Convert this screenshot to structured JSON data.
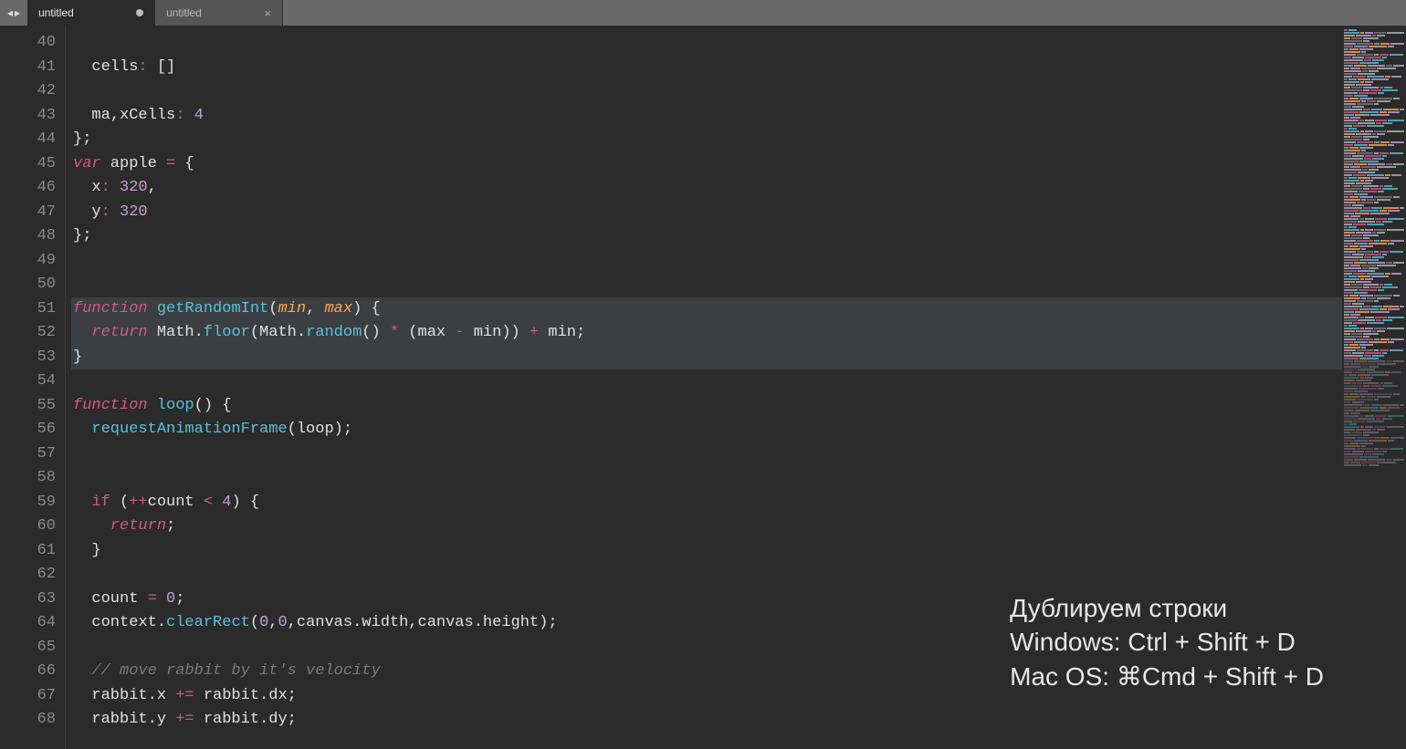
{
  "tabs": [
    {
      "label": "untitled",
      "active": true,
      "dirty": true
    },
    {
      "label": "untitled",
      "active": false,
      "dirty": false
    }
  ],
  "first_line_number": 40,
  "lines": [
    {
      "n": 40,
      "sel": false,
      "tokens": []
    },
    {
      "n": 41,
      "sel": false,
      "tokens": [
        {
          "t": "  ",
          "c": "plain"
        },
        {
          "t": "cells",
          "c": "plain"
        },
        {
          "t": ":",
          "c": "op"
        },
        {
          "t": " [] ",
          "c": "plain"
        }
      ]
    },
    {
      "n": 42,
      "sel": false,
      "tokens": []
    },
    {
      "n": 43,
      "sel": false,
      "tokens": [
        {
          "t": "  ",
          "c": "plain"
        },
        {
          "t": "ma",
          "c": "plain"
        },
        {
          "t": ",",
          "c": "plain"
        },
        {
          "t": "xCells",
          "c": "plain"
        },
        {
          "t": ":",
          "c": "op"
        },
        {
          "t": " ",
          "c": "plain"
        },
        {
          "t": "4",
          "c": "num"
        }
      ]
    },
    {
      "n": 44,
      "sel": false,
      "tokens": [
        {
          "t": "};",
          "c": "plain"
        }
      ]
    },
    {
      "n": 45,
      "sel": false,
      "tokens": [
        {
          "t": "var",
          "c": "kw"
        },
        {
          "t": " apple ",
          "c": "plain"
        },
        {
          "t": "=",
          "c": "op"
        },
        {
          "t": " {",
          "c": "plain"
        }
      ]
    },
    {
      "n": 46,
      "sel": false,
      "tokens": [
        {
          "t": "  x",
          "c": "plain"
        },
        {
          "t": ":",
          "c": "op"
        },
        {
          "t": " ",
          "c": "plain"
        },
        {
          "t": "320",
          "c": "num"
        },
        {
          "t": ",",
          "c": "plain"
        }
      ]
    },
    {
      "n": 47,
      "sel": false,
      "tokens": [
        {
          "t": "  y",
          "c": "plain"
        },
        {
          "t": ":",
          "c": "op"
        },
        {
          "t": " ",
          "c": "plain"
        },
        {
          "t": "320",
          "c": "num"
        }
      ]
    },
    {
      "n": 48,
      "sel": false,
      "tokens": [
        {
          "t": "};",
          "c": "plain"
        }
      ]
    },
    {
      "n": 49,
      "sel": false,
      "tokens": []
    },
    {
      "n": 50,
      "sel": false,
      "tokens": []
    },
    {
      "n": 51,
      "sel": true,
      "tokens": [
        {
          "t": "function",
          "c": "kw"
        },
        {
          "t": " ",
          "c": "plain"
        },
        {
          "t": "getRandomInt",
          "c": "fn"
        },
        {
          "t": "(",
          "c": "plain"
        },
        {
          "t": "min",
          "c": "param"
        },
        {
          "t": ", ",
          "c": "plain"
        },
        {
          "t": "max",
          "c": "param"
        },
        {
          "t": ") {",
          "c": "plain"
        }
      ]
    },
    {
      "n": 52,
      "sel": true,
      "tokens": [
        {
          "t": "  ",
          "c": "plain"
        },
        {
          "t": "return",
          "c": "kw"
        },
        {
          "t": " Math.",
          "c": "plain"
        },
        {
          "t": "floor",
          "c": "fn"
        },
        {
          "t": "(Math.",
          "c": "plain"
        },
        {
          "t": "random",
          "c": "fn"
        },
        {
          "t": "() ",
          "c": "plain"
        },
        {
          "t": "*",
          "c": "op"
        },
        {
          "t": " (max ",
          "c": "plain"
        },
        {
          "t": "-",
          "c": "op"
        },
        {
          "t": " min)) ",
          "c": "plain"
        },
        {
          "t": "+",
          "c": "op"
        },
        {
          "t": " min;",
          "c": "plain"
        }
      ]
    },
    {
      "n": 53,
      "sel": true,
      "tokens": [
        {
          "t": "}",
          "c": "plain"
        }
      ]
    },
    {
      "n": 54,
      "sel": false,
      "tokens": []
    },
    {
      "n": 55,
      "sel": false,
      "tokens": [
        {
          "t": "function",
          "c": "kw"
        },
        {
          "t": " ",
          "c": "plain"
        },
        {
          "t": "loop",
          "c": "fn"
        },
        {
          "t": "() {",
          "c": "plain"
        }
      ]
    },
    {
      "n": 56,
      "sel": false,
      "tokens": [
        {
          "t": "  ",
          "c": "plain"
        },
        {
          "t": "requestAnimationFrame",
          "c": "fn"
        },
        {
          "t": "(loop);",
          "c": "plain"
        }
      ]
    },
    {
      "n": 57,
      "sel": false,
      "tokens": []
    },
    {
      "n": 58,
      "sel": false,
      "tokens": []
    },
    {
      "n": 59,
      "sel": false,
      "tokens": [
        {
          "t": "  ",
          "c": "plain"
        },
        {
          "t": "if",
          "c": "kw2"
        },
        {
          "t": " (",
          "c": "plain"
        },
        {
          "t": "++",
          "c": "op"
        },
        {
          "t": "count ",
          "c": "plain"
        },
        {
          "t": "<",
          "c": "op"
        },
        {
          "t": " ",
          "c": "plain"
        },
        {
          "t": "4",
          "c": "num"
        },
        {
          "t": ") {",
          "c": "plain"
        }
      ]
    },
    {
      "n": 60,
      "sel": false,
      "tokens": [
        {
          "t": "    ",
          "c": "plain"
        },
        {
          "t": "return",
          "c": "kw"
        },
        {
          "t": ";",
          "c": "plain"
        }
      ]
    },
    {
      "n": 61,
      "sel": false,
      "tokens": [
        {
          "t": "  }",
          "c": "plain"
        }
      ]
    },
    {
      "n": 62,
      "sel": false,
      "tokens": []
    },
    {
      "n": 63,
      "sel": false,
      "tokens": [
        {
          "t": "  count ",
          "c": "plain"
        },
        {
          "t": "=",
          "c": "op"
        },
        {
          "t": " ",
          "c": "plain"
        },
        {
          "t": "0",
          "c": "num"
        },
        {
          "t": ";",
          "c": "plain"
        }
      ]
    },
    {
      "n": 64,
      "sel": false,
      "tokens": [
        {
          "t": "  context.",
          "c": "plain"
        },
        {
          "t": "clearRect",
          "c": "fn"
        },
        {
          "t": "(",
          "c": "plain"
        },
        {
          "t": "0",
          "c": "num"
        },
        {
          "t": ",",
          "c": "plain"
        },
        {
          "t": "0",
          "c": "num"
        },
        {
          "t": ",canvas.width,canvas.height);",
          "c": "plain"
        }
      ]
    },
    {
      "n": 65,
      "sel": false,
      "tokens": []
    },
    {
      "n": 66,
      "sel": false,
      "tokens": [
        {
          "t": "  ",
          "c": "plain"
        },
        {
          "t": "// move rabbit by it's velocity",
          "c": "cmt"
        }
      ]
    },
    {
      "n": 67,
      "sel": false,
      "tokens": [
        {
          "t": "  rabbit.x ",
          "c": "plain"
        },
        {
          "t": "+=",
          "c": "op"
        },
        {
          "t": " rabbit.dx;",
          "c": "plain"
        }
      ]
    },
    {
      "n": 68,
      "sel": false,
      "tokens": [
        {
          "t": "  rabbit.y ",
          "c": "plain"
        },
        {
          "t": "+=",
          "c": "op"
        },
        {
          "t": " rabbit.dy;",
          "c": "plain"
        }
      ]
    }
  ],
  "overlay": {
    "title": "Дублируем строки",
    "win": "Windows: Ctrl + Shift + D",
    "mac": "Mac OS: ⌘Cmd + Shift + D"
  },
  "minimap_colors": [
    "#d05a84",
    "#56c1dc",
    "#ffa552",
    "#c79dd7",
    "#7a7a7a",
    "#aeb7bf"
  ]
}
